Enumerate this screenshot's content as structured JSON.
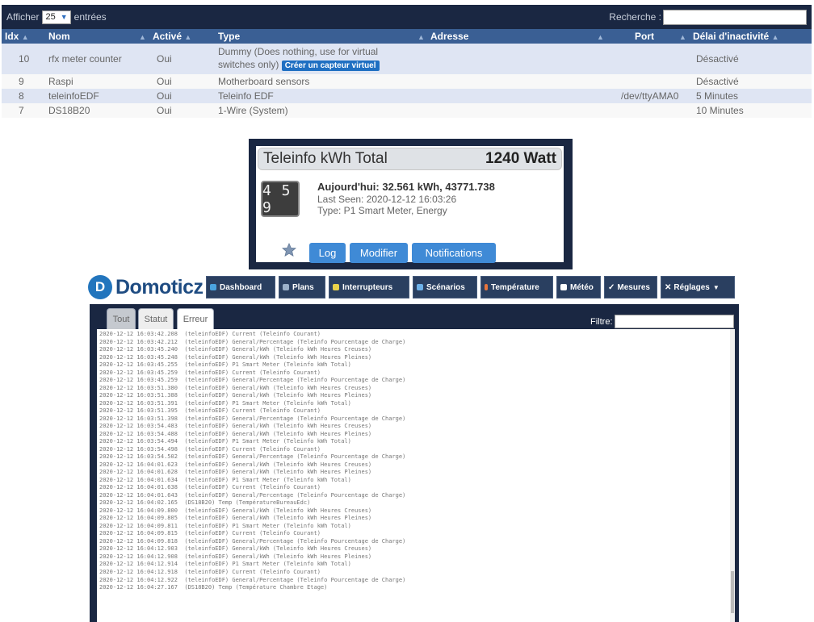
{
  "device_table": {
    "show_label": "Afficher",
    "page_size": "25",
    "entries_label": "entrées",
    "search_label": "Recherche :",
    "columns": [
      "Idx",
      "Nom",
      "Activé",
      "Type",
      "Adresse",
      "Port",
      "Délai d'inactivité"
    ],
    "rows": [
      {
        "idx": "10",
        "nom": "rfx meter counter",
        "active": "Oui",
        "type": "Dummy (Does nothing, use for virtual",
        "type2": "switches only)",
        "button": "Créer un capteur virtuel",
        "adresse": "",
        "port": "",
        "delai": "Désactivé"
      },
      {
        "idx": "9",
        "nom": "Raspi",
        "active": "Oui",
        "type": "Motherboard sensors",
        "adresse": "",
        "port": "",
        "delai": "Désactivé"
      },
      {
        "idx": "8",
        "nom": "teleinfoEDF",
        "active": "Oui",
        "type": "Teleinfo EDF",
        "adresse": "",
        "port": "/dev/ttyAMA0",
        "delai": "5 Minutes"
      },
      {
        "idx": "7",
        "nom": "DS18B20",
        "active": "Oui",
        "type": "1-Wire (System)",
        "adresse": "",
        "port": "",
        "delai": "10 Minutes"
      }
    ]
  },
  "widget": {
    "title": "Teleinfo kWh Total",
    "value": "1240 Watt",
    "meter_digits": "4 5 9",
    "today": "Aujourd'hui: 32.561 kWh, 43771.738",
    "last_seen": "Last Seen: 2020-12-12 16:03:26",
    "type": "Type: P1 Smart Meter, Energy",
    "buttons": {
      "log": "Log",
      "modifier": "Modifier",
      "notifications": "Notifications"
    }
  },
  "domoticz": {
    "logo_letter": "D",
    "logo_name": "Domoticz",
    "menu": [
      "Dashboard",
      "Plans",
      "Interrupteurs",
      "Scénarios",
      "Température",
      "Météo",
      "Mesures",
      "Réglages"
    ],
    "tabs": [
      "Tout",
      "Statut",
      "Erreur"
    ],
    "filter_label": "Filtre:",
    "log_lines": [
      "2020-12-12 16:03:42.208  (teleinfoEDF) Current (Teleinfo Courant)",
      "2020-12-12 16:03:42.212  (teleinfoEDF) General/Percentage (Teleinfo Pourcentage de Charge)",
      "2020-12-12 16:03:45.240  (teleinfoEDF) General/kWh (Teleinfo kWh Heures Creuses)",
      "2020-12-12 16:03:45.248  (teleinfoEDF) General/kWh (Teleinfo kWh Heures Pleines)",
      "2020-12-12 16:03:45.255  (teleinfoEDF) P1 Smart Meter (Teleinfo kWh Total)",
      "2020-12-12 16:03:45.259  (teleinfoEDF) Current (Teleinfo Courant)",
      "2020-12-12 16:03:45.259  (teleinfoEDF) General/Percentage (Teleinfo Pourcentage de Charge)",
      "2020-12-12 16:03:51.380  (teleinfoEDF) General/kWh (Teleinfo kWh Heures Creuses)",
      "2020-12-12 16:03:51.388  (teleinfoEDF) General/kWh (Teleinfo kWh Heures Pleines)",
      "2020-12-12 16:03:51.391  (teleinfoEDF) P1 Smart Meter (Teleinfo kWh Total)",
      "2020-12-12 16:03:51.395  (teleinfoEDF) Current (Teleinfo Courant)",
      "2020-12-12 16:03:51.398  (teleinfoEDF) General/Percentage (Teleinfo Pourcentage de Charge)",
      "2020-12-12 16:03:54.483  (teleinfoEDF) General/kWh (Teleinfo kWh Heures Creuses)",
      "2020-12-12 16:03:54.488  (teleinfoEDF) General/kWh (Teleinfo kWh Heures Pleines)",
      "2020-12-12 16:03:54.494  (teleinfoEDF) P1 Smart Meter (Teleinfo kWh Total)",
      "2020-12-12 16:03:54.498  (teleinfoEDF) Current (Teleinfo Courant)",
      "2020-12-12 16:03:54.502  (teleinfoEDF) General/Percentage (Teleinfo Pourcentage de Charge)",
      "2020-12-12 16:04:01.623  (teleinfoEDF) General/kWh (Teleinfo kWh Heures Creuses)",
      "2020-12-12 16:04:01.628  (teleinfoEDF) General/kWh (Teleinfo kWh Heures Pleines)",
      "2020-12-12 16:04:01.634  (teleinfoEDF) P1 Smart Meter (Teleinfo kWh Total)",
      "2020-12-12 16:04:01.638  (teleinfoEDF) Current (Teleinfo Courant)",
      "2020-12-12 16:04:01.643  (teleinfoEDF) General/Percentage (Teleinfo Pourcentage de Charge)",
      "2020-12-12 16:04:02.165  (DS18B20) Temp (TempératureBureauEdc)",
      "2020-12-12 16:04:09.800  (teleinfoEDF) General/kWh (Teleinfo kWh Heures Creuses)",
      "2020-12-12 16:04:09.805  (teleinfoEDF) General/kWh (Teleinfo kWh Heures Pleines)",
      "2020-12-12 16:04:09.811  (teleinfoEDF) P1 Smart Meter (Teleinfo kWh Total)",
      "2020-12-12 16:04:09.815  (teleinfoEDF) Current (Teleinfo Courant)",
      "2020-12-12 16:04:09.818  (teleinfoEDF) General/Percentage (Teleinfo Pourcentage de Charge)",
      "2020-12-12 16:04:12.903  (teleinfoEDF) General/kWh (Teleinfo kWh Heures Creuses)",
      "2020-12-12 16:04:12.908  (teleinfoEDF) General/kWh (Teleinfo kWh Heures Pleines)",
      "2020-12-12 16:04:12.914  (teleinfoEDF) P1 Smart Meter (Teleinfo kWh Total)",
      "2020-12-12 16:04:12.918  (teleinfoEDF) Current (Teleinfo Courant)",
      "2020-12-12 16:04:12.922  (teleinfoEDF) General/Percentage (Teleinfo Pourcentage de Charge)",
      "2020-12-12 16:04:27.167  (DS18B20) Temp (Température Chambre Etage)"
    ]
  },
  "colors": {
    "navy": "#1a2742",
    "header_blue": "#3a5f94",
    "accent_blue": "#3f8ad6",
    "row_highlight": "#dfe5f3"
  }
}
